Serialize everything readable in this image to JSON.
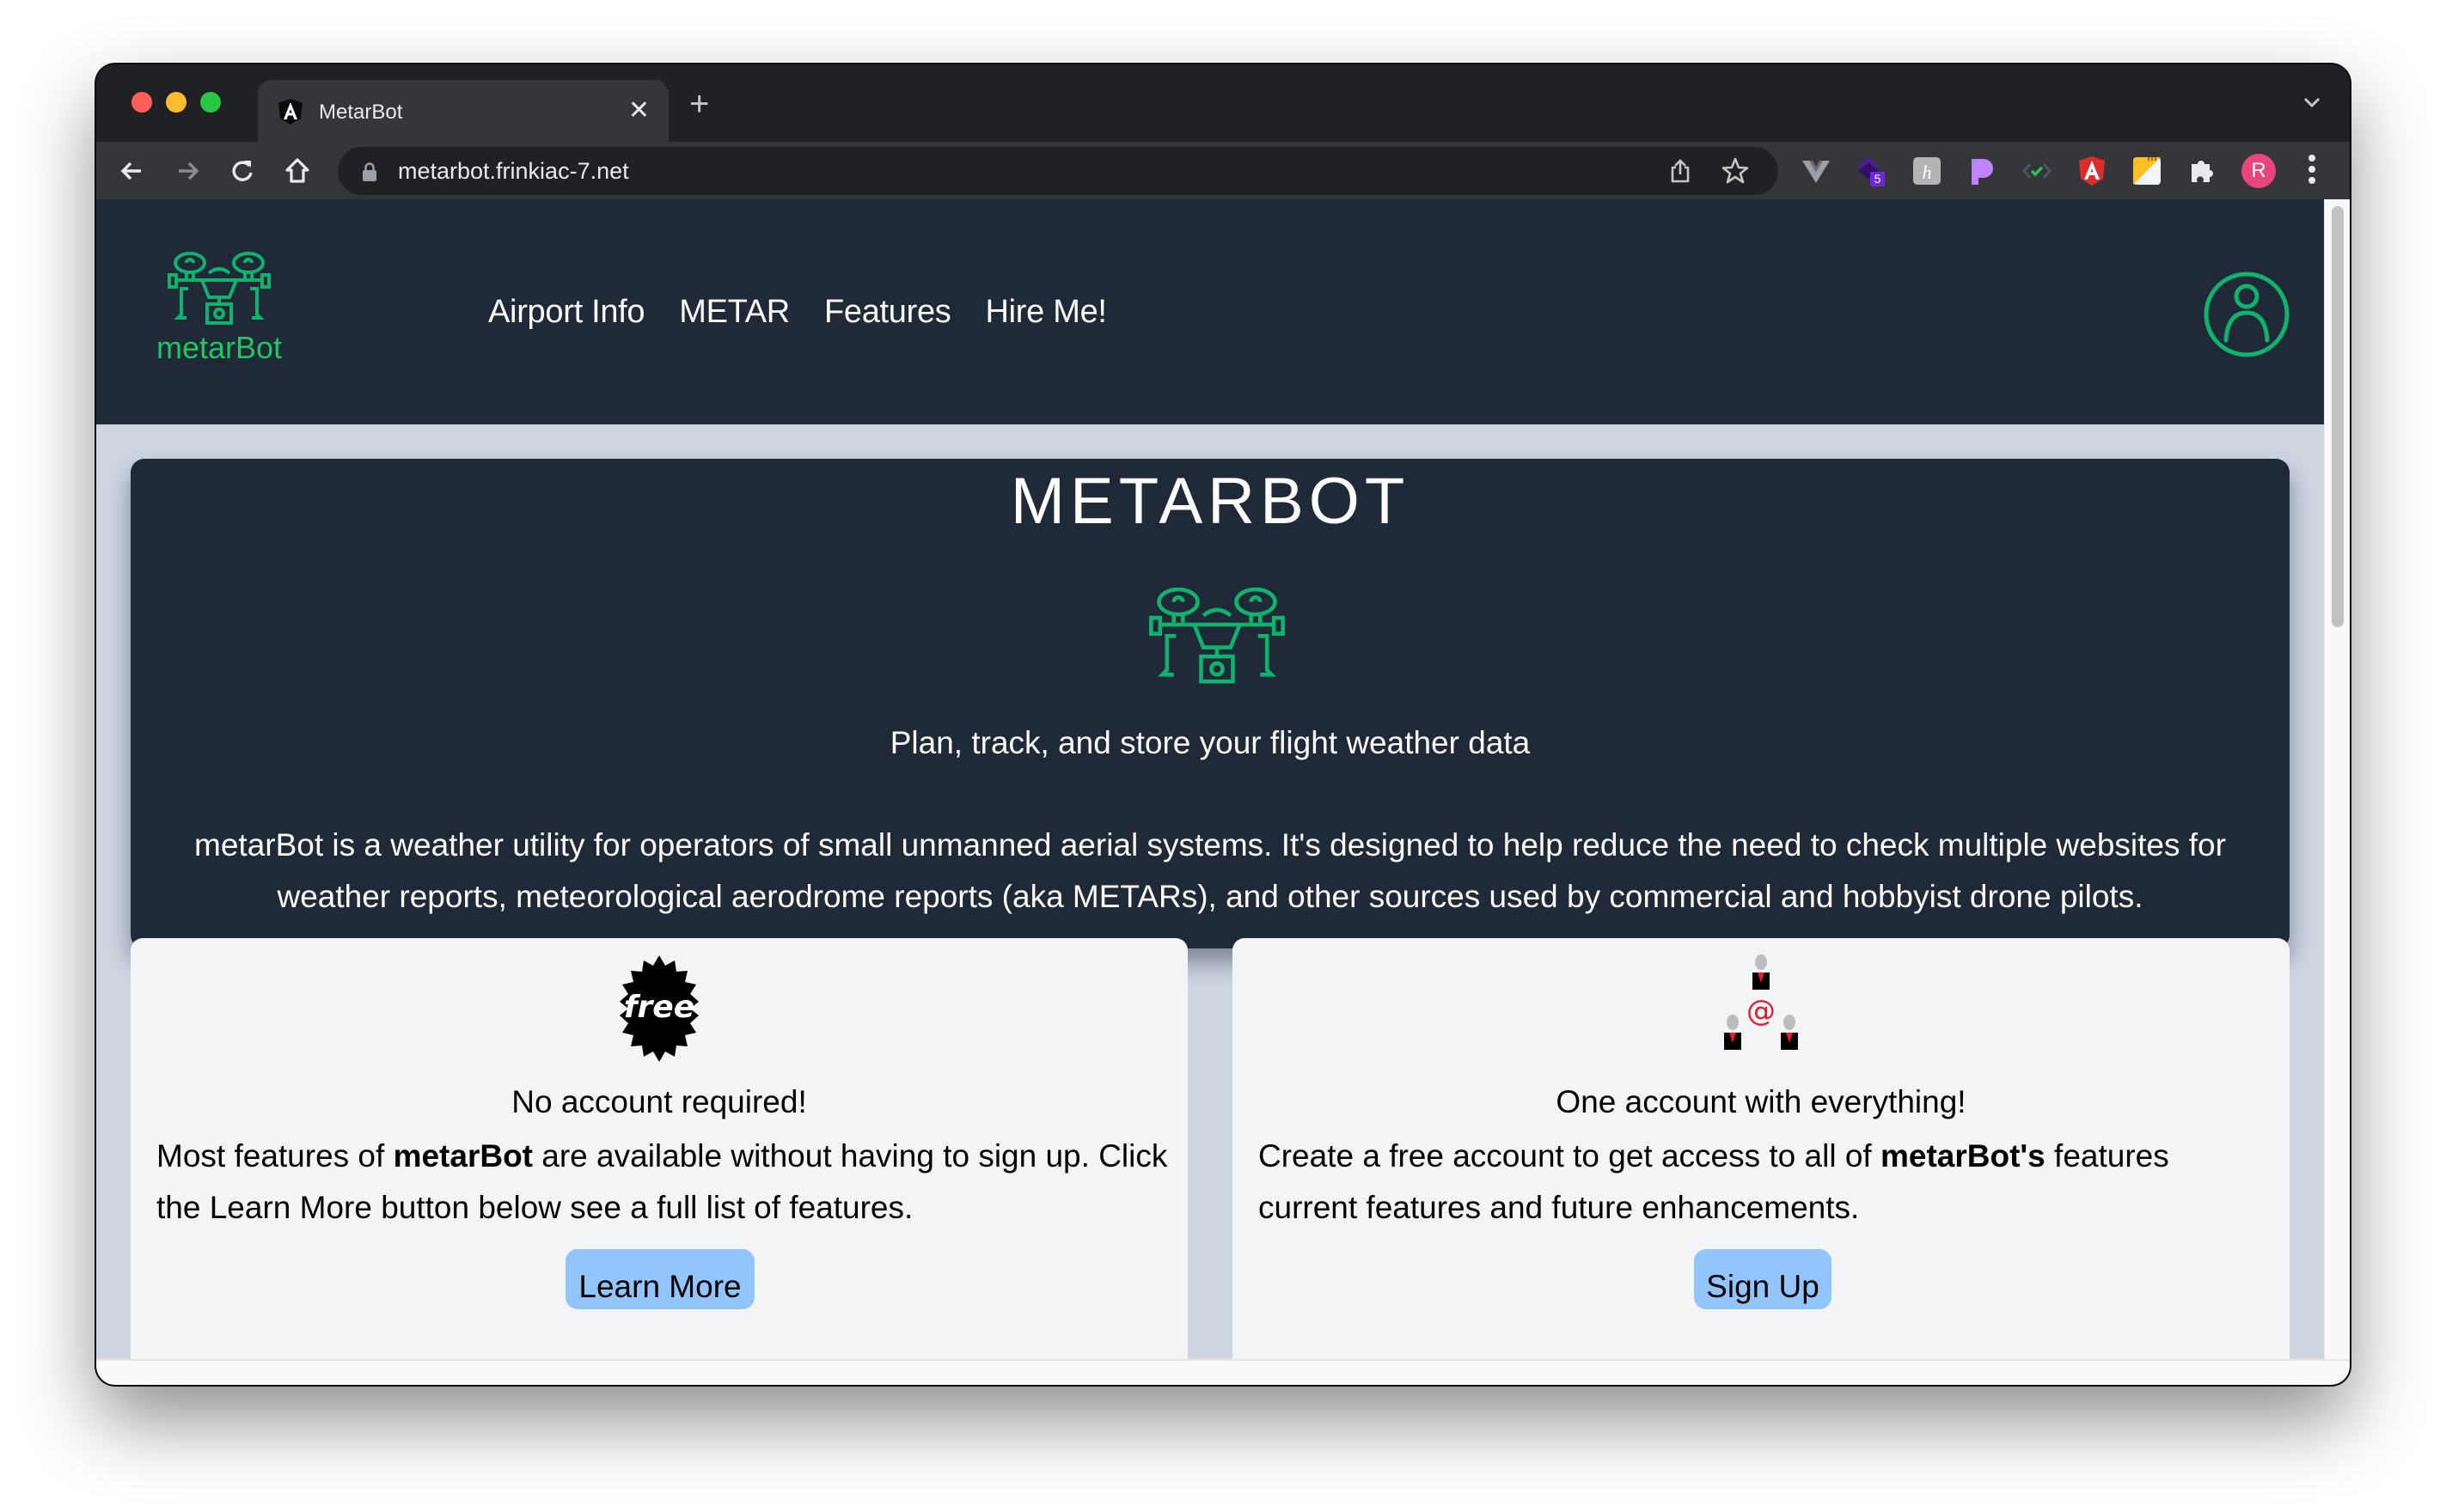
{
  "browser": {
    "tab": {
      "title": "MetarBot",
      "favicon": "angular-icon",
      "close_glyph": "✕"
    },
    "new_tab_glyph": "+",
    "url": "metarbot.frinkiac-7.net",
    "extensions": [
      {
        "name": "vue-devtools-icon",
        "color": "#9aa0a6"
      },
      {
        "name": "stack-extension-icon",
        "color": "#4c1d95",
        "badge": "5"
      },
      {
        "name": "hemingway-icon",
        "color": "#b0b0b0"
      },
      {
        "name": "patreon-like-icon",
        "color": "#c084fc"
      },
      {
        "name": "code-check-icon",
        "color": "#22c55e"
      },
      {
        "name": "angular-devtools-icon",
        "color": "#dd2c2c"
      },
      {
        "name": "notes-extension-icon",
        "color": "#fbbf24"
      },
      {
        "name": "extensions-puzzle-icon",
        "color": "#e8eaed"
      }
    ],
    "profile_initial": "R"
  },
  "appbar": {
    "brand": "metarBot",
    "nav": [
      "Airport Info",
      "METAR",
      "Features",
      "Hire Me!"
    ]
  },
  "hero": {
    "title": "METARBOT",
    "tagline": "Plan, track, and store your flight weather data",
    "description": "metarBot is a weather utility for operators of small unmanned aerial systems. It's designed to help reduce the need to check multiple websites for weather reports, meteorological aerodrome reports (aka METARs), and other sources used by commercial and hobbyist drone pilots."
  },
  "cards": [
    {
      "icon": "free-badge-icon",
      "icon_text": "free",
      "title": "No account required!",
      "body_pre": "Most features of ",
      "body_bold": "metarBot",
      "body_post": " are available without having to sign up. Click the Learn More button below see a full list of features.",
      "button": "Learn More"
    },
    {
      "icon": "account-network-icon",
      "icon_text": "@",
      "title": "One account with everything!",
      "body_pre": "Create a free account to get access to all of ",
      "body_bold": "metarBot's",
      "body_post": " features current features and future enhancements.",
      "button": "Sign Up"
    }
  ],
  "colors": {
    "accent_green": "#22c55e",
    "appbar_bg": "#1f2937",
    "page_bg": "#cdd5e1",
    "card_bg": "#f3f4f6",
    "button_bg": "#93c5fd"
  }
}
